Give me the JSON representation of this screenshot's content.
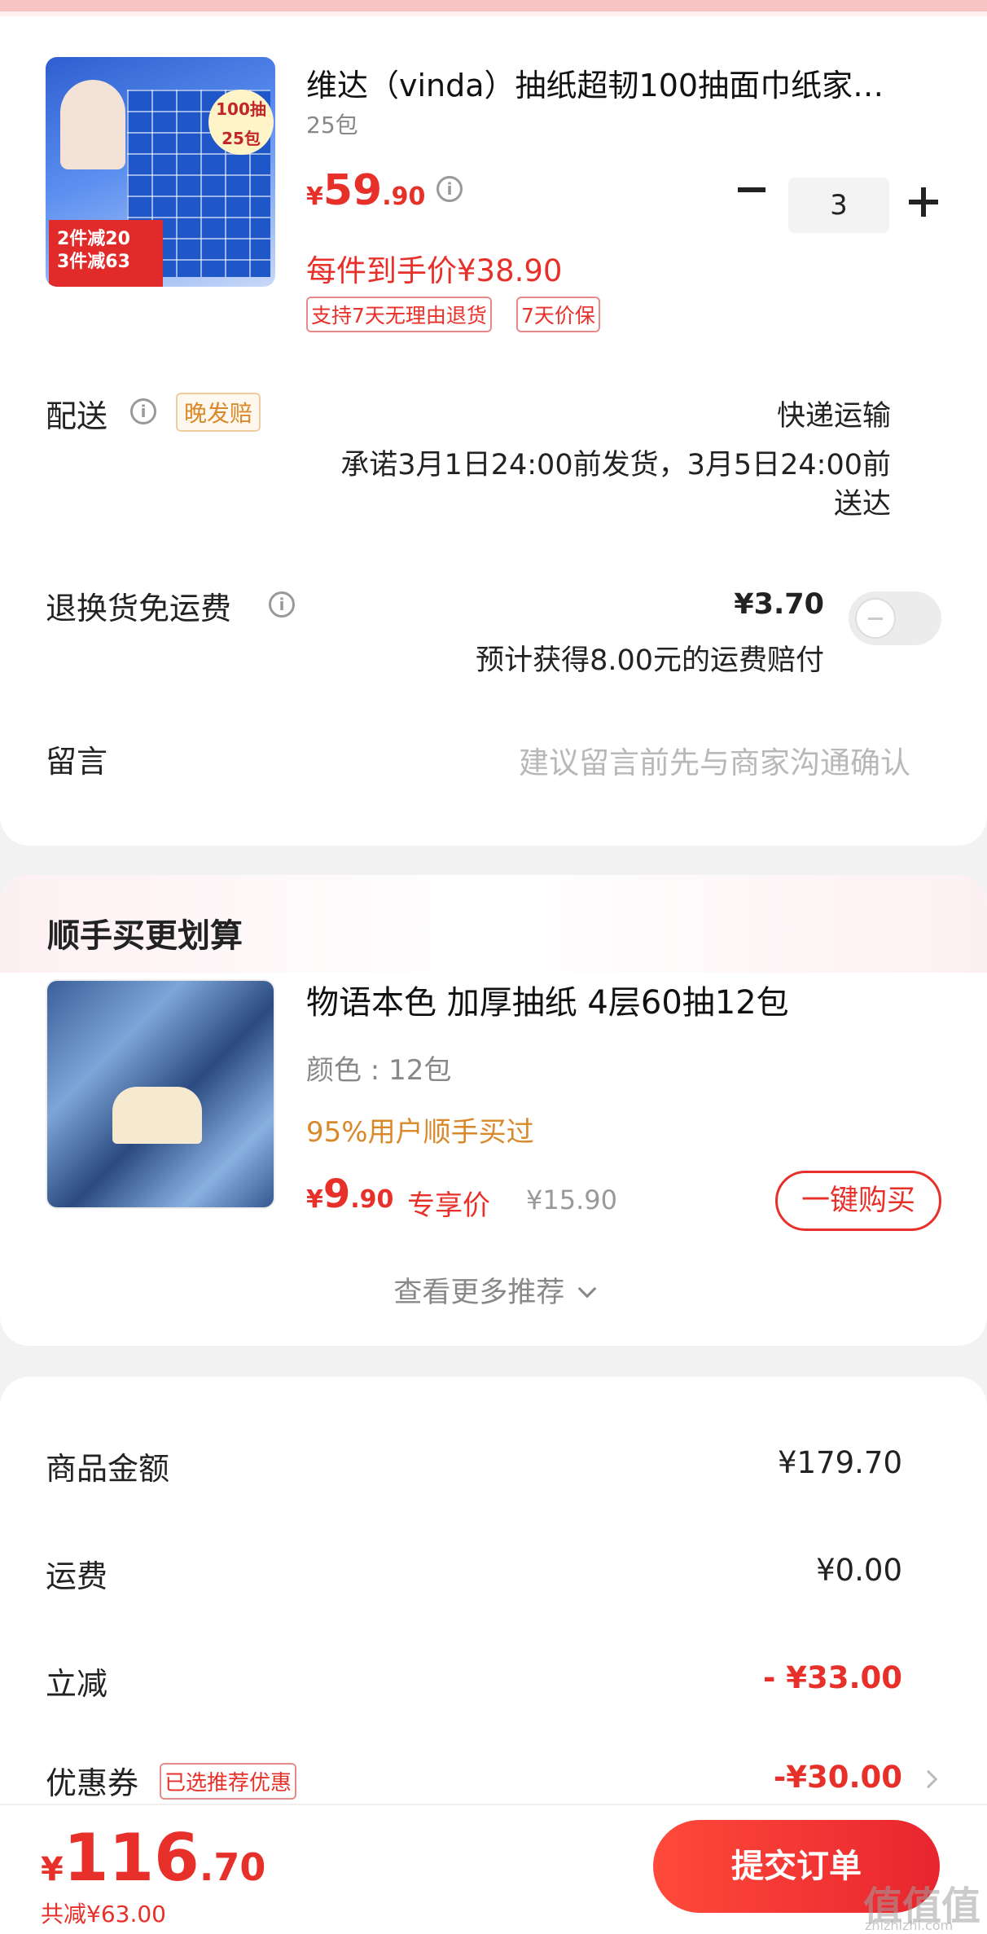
{
  "product": {
    "title": "维达（vinda）抽纸超韧100抽面巾纸家…",
    "spec": "25包",
    "price_currency": "¥",
    "price_int": "59",
    "price_dec": ".90",
    "unit_price": "每件到手价¥38.90",
    "tags": [
      "支持7天无理由退货",
      "7天价保"
    ],
    "quantity": "3",
    "image_texts": {
      "badge": "100抽\n25包",
      "promo": "2件减20\n3件减63"
    }
  },
  "delivery": {
    "label": "配送",
    "late_badge": "晚发赔",
    "method": "快递运输",
    "promise_line1": "承诺3月1日24:00前发货，3月5日24:00前",
    "promise_line2": "送达"
  },
  "return_fee": {
    "label": "退换货免运费",
    "price": "¥3.70",
    "desc": "预计获得8.00元的运费赔付",
    "enabled": false
  },
  "message": {
    "label": "留言",
    "placeholder": "建议留言前先与商家沟通确认"
  },
  "recommend": {
    "section_title": "顺手买更划算",
    "title": "物语本色 加厚抽纸 4层60抽12包",
    "spec": "颜色 : 12包",
    "social": "95%用户顺手买过",
    "price_currency": "¥",
    "price_int": "9",
    "price_dec": ".90",
    "exclusive_label": "专享价",
    "original_price": "¥15.90",
    "buy_button": "一键购买",
    "more": "查看更多推荐"
  },
  "summary": {
    "rows": [
      {
        "label": "商品金额",
        "value": "¥179.70"
      },
      {
        "label": "运费",
        "value": "¥0.00"
      },
      {
        "label": "立减",
        "value": "- ¥33.00"
      },
      {
        "label": "优惠券",
        "value": "-¥30.00",
        "badge": "已选推荐优惠"
      }
    ]
  },
  "bottom": {
    "total_currency": "¥",
    "total_int": "116",
    "total_dec": ".70",
    "saved": "共减¥63.00",
    "submit": "提交订单",
    "watermark": "值值值",
    "watermark_url": "zhizhizhi.com"
  },
  "colors": {
    "accent": "#e8302a",
    "orange": "#d9882a"
  }
}
